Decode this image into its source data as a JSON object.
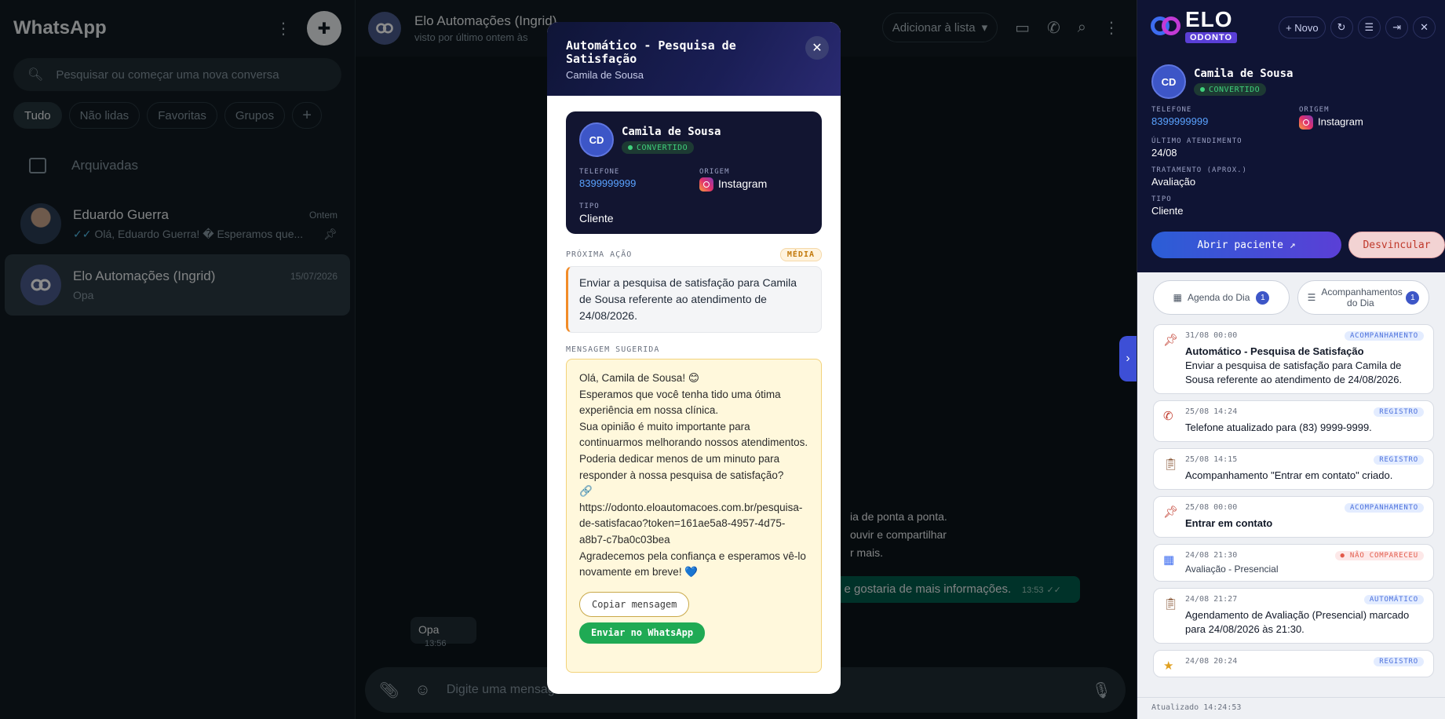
{
  "left": {
    "brand": "WhatsApp",
    "search_placeholder": "Pesquisar ou começar uma nova conversa",
    "chips": [
      "Tudo",
      "Não lidas",
      "Favoritas",
      "Grupos"
    ],
    "archived": "Arquivadas",
    "chats": [
      {
        "name": "Eduardo Guerra",
        "time": "Ontem",
        "preview": "Olá, Eduardo Guerra! � Esperamos que..."
      },
      {
        "name": "Elo Automações (Ingrid)",
        "time": "15/07/2026",
        "preview": "Opa"
      }
    ]
  },
  "center": {
    "contact_name": "Elo Automações (Ingrid)",
    "contact_status": "visto por último ontem às",
    "list_button": "Adicionar à lista",
    "out_line1": "ia de ponta a ponta.",
    "out_line2": "ouvir e compartilhar",
    "out_line3": "r mais.",
    "out_msg2": "o e gostaria de mais informações.",
    "out_msg2_time": "13:53",
    "in_msg": "Opa",
    "in_msg_time": "13:56",
    "composer_placeholder": "Digite uma mensagem"
  },
  "modal": {
    "title": "Automático - Pesquisa de Satisfação",
    "subtitle": "Camila de Sousa",
    "initials": "CD",
    "patient_name": "Camila de Sousa",
    "status": "CONVERTIDO",
    "phone_label": "TELEFONE",
    "phone": "8399999999",
    "origin_label": "ORIGEM",
    "origin": "Instagram",
    "type_label": "TIPO",
    "type": "Cliente",
    "next_action_label": "PRÓXIMA AÇÃO",
    "priority": "MÉDIA",
    "next_action": "Enviar a pesquisa de satisfação para Camila de Sousa referente ao atendimento de 24/08/2026.",
    "suggested_label": "MENSAGEM SUGERIDA",
    "message_lines": [
      "Olá, Camila de Sousa! 😊",
      "Esperamos que você tenha tido uma ótima experiência em nossa clínica.",
      "Sua opinião é muito importante para continuarmos melhorando nossos atendimentos. Poderia dedicar menos de um minuto para responder à nossa pesquisa de satisfação?",
      "🔗 https://odonto.eloautomacoes.com.br/pesquisa-de-satisfacao?token=161ae5a8-4957-4d75-a8b7-c7ba0c03bea",
      "Agradecemos pela confiança e esperamos vê-lo novamente em breve! 💙"
    ],
    "copy_button": "Copiar mensagem",
    "send_button": "Enviar no WhatsApp"
  },
  "right": {
    "logo_main": "ELO",
    "logo_sub": "ODONTO",
    "new_button": "+ Novo",
    "initials": "CD",
    "patient_name": "Camila de Sousa",
    "status": "CONVERTIDO",
    "phone_label": "TELEFONE",
    "phone": "8399999999",
    "origin_label": "ORIGEM",
    "origin": "Instagram",
    "last_label": "ÚLTIMO ATENDIMENTO",
    "last": "24/08",
    "treat_label": "TRATAMENTO (APROX.)",
    "treat": "Avaliação",
    "type_label": "TIPO",
    "type": "Cliente",
    "open_button": "Abrir paciente ↗",
    "unlink_button": "Desvincular",
    "tab_agenda": "Agenda do Dia",
    "tab_agenda_count": "1",
    "tab_acomp": "Acompanhamentos do Dia",
    "tab_acomp_count": "1",
    "timeline": [
      {
        "icon": "pin-icon",
        "date": "31/08 00:00",
        "tag": "ACOMPANHAMENTO",
        "title": "Automático - Pesquisa de Satisfação",
        "desc": "Enviar a pesquisa de satisfação para Camila de Sousa referente ao atendimento de 24/08/2026."
      },
      {
        "icon": "phone-icon",
        "date": "25/08 14:24",
        "tag": "REGISTRO",
        "title": "Telefone atualizado para (83) 9999-9999."
      },
      {
        "icon": "clipboard-icon",
        "date": "25/08 14:15",
        "tag": "REGISTRO",
        "title": "Acompanhamento \"Entrar em contato\" criado."
      },
      {
        "icon": "pin-icon",
        "date": "25/08 00:00",
        "tag": "ACOMPANHAMENTO",
        "title": "Entrar em contato"
      },
      {
        "icon": "calendar-icon",
        "date": "24/08 21:30",
        "tag": "● NÃO COMPARECEU",
        "title": "Avaliação - Presencial"
      },
      {
        "icon": "clipboard-icon",
        "date": "24/08 21:27",
        "tag": "AUTOMÁTICO",
        "title": "Agendamento de Avaliação (Presencial) marcado para 24/08/2026 às 21:30."
      },
      {
        "icon": "star-icon",
        "date": "24/08 20:24",
        "tag": "REGISTRO",
        "title": ""
      }
    ],
    "footer": "Atualizado 14:24:53"
  }
}
